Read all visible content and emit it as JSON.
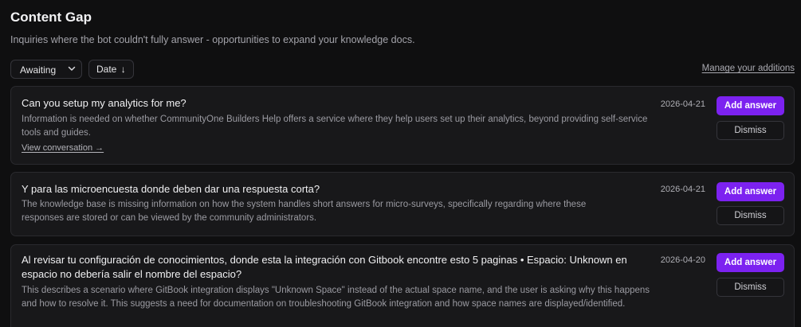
{
  "header": {
    "title": "Content Gap",
    "subtitle": "Inquiries where the bot couldn't fully answer - opportunities to expand your knowledge docs."
  },
  "toolbar": {
    "status_filter": {
      "selected": "Awaiting",
      "icon": "chevron-down-icon"
    },
    "sort_label": "Date",
    "sort_arrow": "↓",
    "manage_link": "Manage your additions"
  },
  "actions": {
    "add_label": "Add answer",
    "dismiss_label": "Dismiss",
    "view_conversation": "View conversation →"
  },
  "colors": {
    "accent": "#7c22f0",
    "background": "#0f0f10",
    "card": "#18181a"
  },
  "items": [
    {
      "question": "Can you setup my analytics for me?",
      "description": "Information is needed on whether CommunityOne Builders Help offers a service where they help users set up their analytics, beyond providing self-service tools and guides.",
      "date": "2026-04-21"
    },
    {
      "question": "Y para las microencuesta donde deben dar una respuesta corta?",
      "description": "The knowledge base is missing information on how the system handles short answers for micro-surveys, specifically regarding where these responses are stored or can be viewed by the community administrators.",
      "date": "2026-04-21"
    },
    {
      "question": "Al revisar tu configuración de conocimientos, donde esta la integración con Gitbook encontre esto 5 paginas • Espacio: Unknown en espacio no debería salir el nombre del espacio?",
      "description": "This describes a scenario where GitBook integration displays \"Unknown Space\" instead of the actual space name, and the user is asking why this happens and how to resolve it. This suggests a need for documentation on troubleshooting GitBook integration and how space names are displayed/identified.",
      "date": "2026-04-20"
    }
  ]
}
